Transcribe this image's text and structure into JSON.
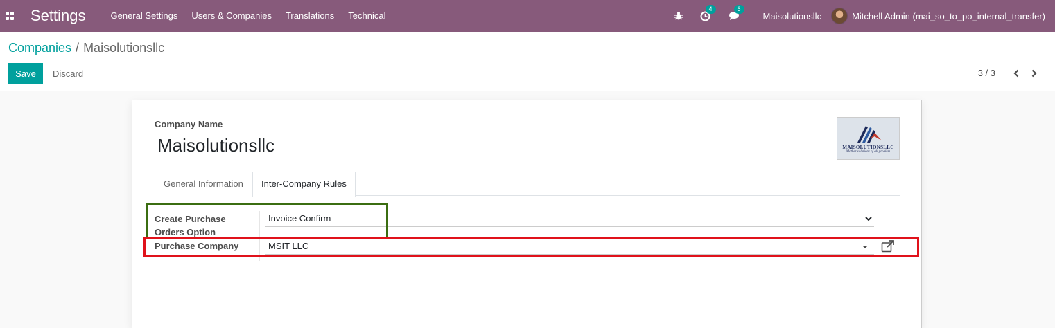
{
  "navbar": {
    "app_title": "Settings",
    "menu": [
      "General Settings",
      "Users & Companies",
      "Translations",
      "Technical"
    ],
    "activity_count": "4",
    "message_count": "6",
    "company": "Maisolutionsllc",
    "user": "Mitchell Admin (mai_so_to_po_internal_transfer)"
  },
  "breadcrumb": {
    "parent": "Companies",
    "separator": "/",
    "current": "Maisolutionsllc"
  },
  "buttons": {
    "save": "Save",
    "discard": "Discard"
  },
  "pager": {
    "text": "3 / 3"
  },
  "form": {
    "company_name_label": "Company Name",
    "company_name": "Maisolutionsllc",
    "logo": {
      "name": "MAISOLUTIONSLLC",
      "tagline": "Mother solutions of all problem"
    },
    "tabs": [
      "General Information",
      "Inter-Company Rules"
    ],
    "active_tab": "Inter-Company Rules",
    "fields": {
      "create_po_label_line1": "Create Purchase",
      "create_po_label_line2": "Orders Option",
      "create_po_value": "Invoice Confirm",
      "purchase_company_label": "Purchase Company",
      "purchase_company_value": "MSIT LLC"
    }
  },
  "colors": {
    "navbar": "#875a7b",
    "primary": "#00a09d",
    "highlight_green": "#3b6d11",
    "highlight_red": "#e0121b"
  }
}
